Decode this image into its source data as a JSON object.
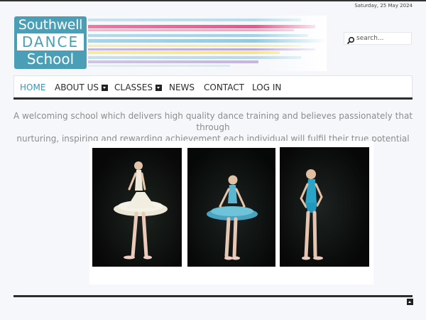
{
  "header": {
    "date": "Saturday, 25 May 2024",
    "logo": {
      "line1": "Southwell",
      "line2": "DANCE",
      "line3": "School",
      "color": "#4a9fb7"
    },
    "search": {
      "placeholder": "search...",
      "icon": "search-icon"
    }
  },
  "nav": {
    "items": [
      {
        "label": "HOME",
        "active": true
      },
      {
        "label": "ABOUT US",
        "dropdown": true
      },
      {
        "label": "CLASSES",
        "dropdown": true
      },
      {
        "label": "NEWS"
      },
      {
        "label": "CONTACT"
      },
      {
        "label": "LOG IN"
      }
    ],
    "accent": "#3e95b3"
  },
  "main": {
    "tagline_line1": "A welcoming school which delivers high quality dance training and believes passionately that through",
    "tagline_line2": "nurturing, inspiring and rewarding achievement each individual will fulfil their true potential",
    "photos": [
      {
        "subject": "dancer-white-tutu",
        "costume_color": "#e8e6d8"
      },
      {
        "subject": "dancer-blue-tutu",
        "costume_color": "#5cb6cf"
      },
      {
        "subject": "dancer-blue-leotard",
        "costume_color": "#2aa5c8"
      }
    ]
  },
  "footer": {
    "back_to_top_icon": "arrow-up-icon"
  }
}
